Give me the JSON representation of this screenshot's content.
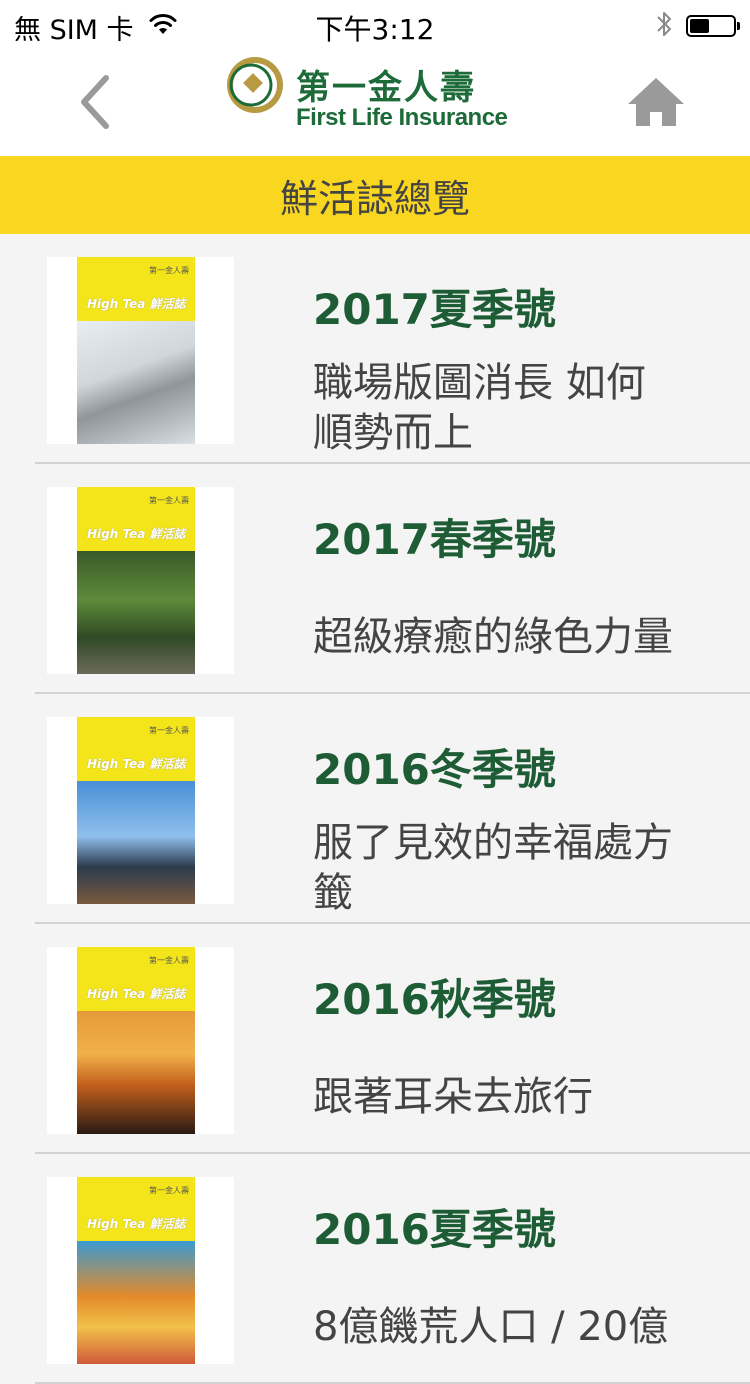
{
  "status_bar": {
    "carrier": "無 SIM 卡",
    "time": "下午3:12",
    "battery_level": 0.45
  },
  "nav": {
    "logo_cn": "第一金人壽",
    "logo_en": "First Life Insurance"
  },
  "header": {
    "title": "鮮活誌總覽"
  },
  "colors": {
    "brand_green": "#1d5c35",
    "header_yellow": "#f9d620",
    "background": "#f4f4f4"
  },
  "issues": [
    {
      "title": "2017夏季號",
      "desc_lines": [
        "職場版圖消長 如何",
        "順勢而上"
      ],
      "cover_brand": "第一金人壽",
      "cover_title": "High Tea 鮮活誌"
    },
    {
      "title": "2017春季號",
      "desc_lines": [
        "超級療癒的綠色力量"
      ],
      "cover_brand": "第一金人壽",
      "cover_title": "High Tea 鮮活誌"
    },
    {
      "title": "2016冬季號",
      "desc_lines": [
        "服了見效的幸福處方",
        "籤"
      ],
      "cover_brand": "第一金人壽",
      "cover_title": "High Tea 鮮活誌"
    },
    {
      "title": "2016秋季號",
      "desc_lines": [
        "跟著耳朵去旅行"
      ],
      "cover_brand": "第一金人壽",
      "cover_title": "High Tea 鮮活誌"
    },
    {
      "title": "2016夏季號",
      "desc_lines": [
        "8億饑荒人口 / 20億"
      ],
      "cover_brand": "第一金人壽",
      "cover_title": "High Tea 鮮活誌"
    }
  ]
}
